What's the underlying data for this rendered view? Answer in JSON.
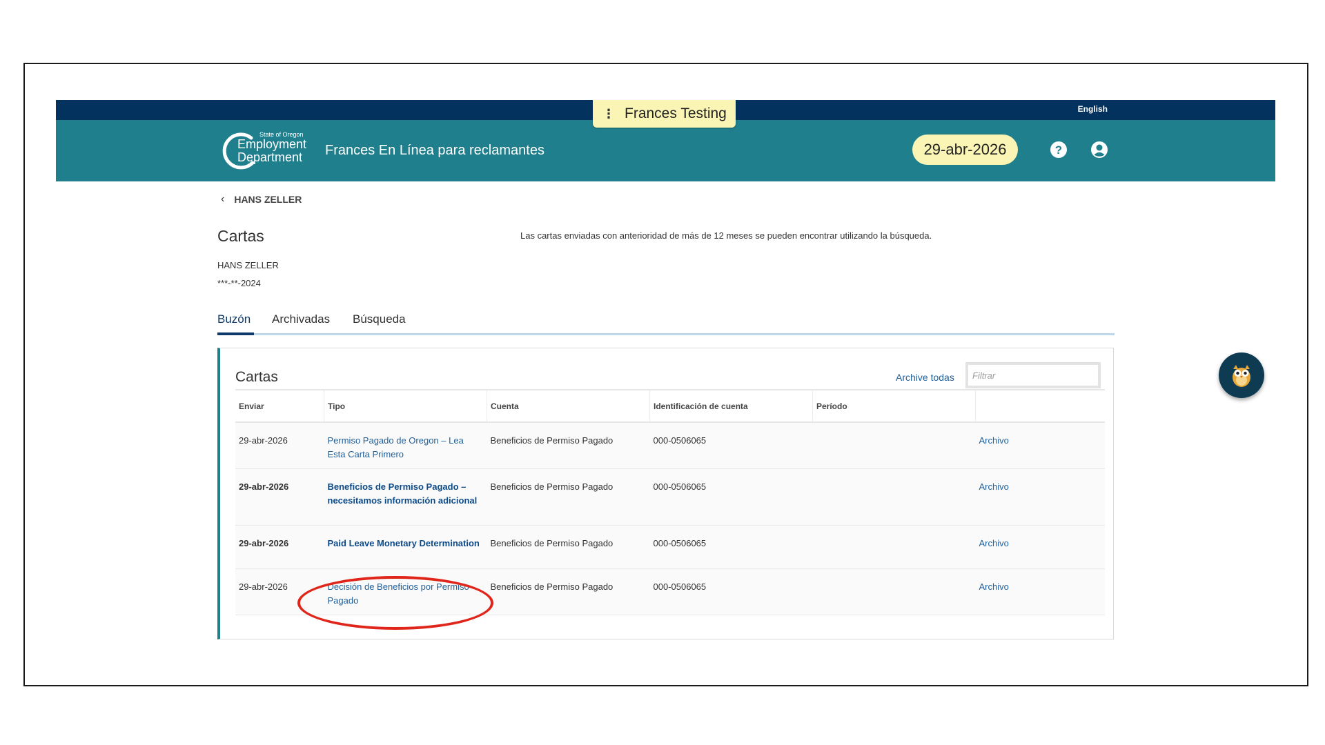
{
  "header": {
    "language": "English",
    "environment": "Frances Testing",
    "logo": {
      "line1": "State of Oregon",
      "line2": "Employment",
      "line3": "Department"
    },
    "app_title": "Frances En Línea para reclamantes",
    "date": "29-abr-2026",
    "icons": {
      "help": "help-icon",
      "user": "user-account-icon",
      "menu": "kebab-menu-icon"
    }
  },
  "breadcrumb": {
    "back_icon": "chevron-left-icon",
    "label": "HANS ZELLER"
  },
  "page": {
    "title": "Cartas",
    "notice": "Las cartas enviadas con anterioridad de más de 12 meses se pueden encontrar utilizando la búsqueda.",
    "claimant_name": "HANS ZELLER",
    "claimant_ssn": "***-**-2024"
  },
  "tabs": [
    {
      "label": "Buzón",
      "active": true
    },
    {
      "label": "Archivadas",
      "active": false
    },
    {
      "label": "Búsqueda",
      "active": false
    }
  ],
  "letters": {
    "title": "Cartas",
    "archive_all": "Archive todas",
    "filter_placeholder": "Filtrar",
    "columns": [
      "Enviar",
      "Tipo",
      "Cuenta",
      "Identificación de cuenta",
      "Período",
      ""
    ],
    "rows": [
      {
        "sent": "29-abr-2026",
        "type": "Permiso Pagado de Oregon – Lea Esta Carta Primero",
        "account": "Beneficios de Permiso Pagado",
        "account_id": "000-0506065",
        "period": "",
        "action": "Archivo",
        "unread": false
      },
      {
        "sent": "29-abr-2026",
        "type": "Beneficios de Permiso Pagado – necesitamos información adicional",
        "account": "Beneficios de Permiso Pagado",
        "account_id": "000-0506065",
        "period": "",
        "action": "Archivo",
        "unread": true
      },
      {
        "sent": "29-abr-2026",
        "type": "Paid Leave Monetary Determination",
        "account": "Beneficios de Permiso Pagado",
        "account_id": "000-0506065",
        "period": "",
        "action": "Archivo",
        "unread": true
      },
      {
        "sent": "29-abr-2026",
        "type": "Decisión de Beneficios por Permiso Pagado",
        "account": "Beneficios de Permiso Pagado",
        "account_id": "000-0506065",
        "period": "",
        "action": "Archivo",
        "unread": false
      }
    ]
  },
  "colors": {
    "navy": "#04325f",
    "teal": "#1f7f8c",
    "pill_yellow": "#fbf5b5",
    "link_blue": "#1f5f9a",
    "annotation_red": "#e0251b"
  },
  "assistant": {
    "icon": "owl-assistant-icon"
  }
}
